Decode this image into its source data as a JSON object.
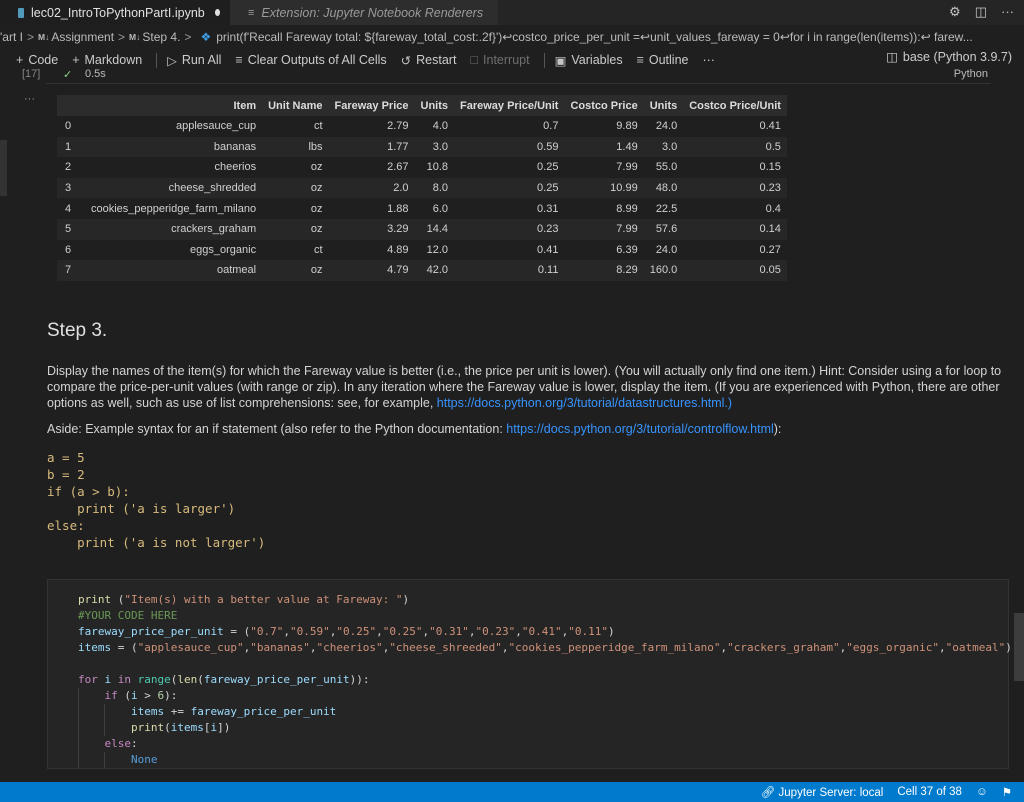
{
  "tabs": [
    {
      "label": "lec02_IntroToPythonPartI.ipynb",
      "modified": true
    },
    {
      "label": "Extension: Jupyter Notebook Renderers"
    }
  ],
  "breadcrumb": {
    "items": [
      "'art I",
      "Assignment",
      "Step 4."
    ],
    "cell_preview": "print(f'Recall Fareway total: ${fareway_total_cost:.2f}')↩costco_price_per_unit =↩unit_values_fareway = 0↩for i in range(len(items)):↩    farew..."
  },
  "toolbar": {
    "code": "Code",
    "markdown": "Markdown",
    "run_all": "Run All",
    "clear_outputs": "Clear Outputs of All Cells",
    "restart": "Restart",
    "interrupt": "Interrupt",
    "variables": "Variables",
    "outline": "Outline",
    "more": "···",
    "kernel": "base (Python 3.9.7)"
  },
  "cell_status": {
    "count": "[17]",
    "time": "0.5s",
    "language": "Python"
  },
  "dataframe": {
    "columns": [
      "",
      "Item",
      "Unit Name",
      "Fareway Price",
      "Units",
      "Fareway Price/Unit",
      "Costco Price",
      "Units",
      "Costco Price/Unit"
    ],
    "rows": [
      [
        "0",
        "applesauce_cup",
        "ct",
        "2.79",
        "4.0",
        "0.7",
        "9.89",
        "24.0",
        "0.41"
      ],
      [
        "1",
        "bananas",
        "lbs",
        "1.77",
        "3.0",
        "0.59",
        "1.49",
        "3.0",
        "0.5"
      ],
      [
        "2",
        "cheerios",
        "oz",
        "2.67",
        "10.8",
        "0.25",
        "7.99",
        "55.0",
        "0.15"
      ],
      [
        "3",
        "cheese_shredded",
        "oz",
        "2.0",
        "8.0",
        "0.25",
        "10.99",
        "48.0",
        "0.23"
      ],
      [
        "4",
        "cookies_pepperidge_farm_milano",
        "oz",
        "1.88",
        "6.0",
        "0.31",
        "8.99",
        "22.5",
        "0.4"
      ],
      [
        "5",
        "crackers_graham",
        "oz",
        "3.29",
        "14.4",
        "0.23",
        "7.99",
        "57.6",
        "0.14"
      ],
      [
        "6",
        "eggs_organic",
        "ct",
        "4.89",
        "12.0",
        "0.41",
        "6.39",
        "24.0",
        "0.27"
      ],
      [
        "7",
        "oatmeal",
        "oz",
        "4.79",
        "42.0",
        "0.11",
        "8.29",
        "160.0",
        "0.05"
      ]
    ]
  },
  "markdown": {
    "heading": "Step 3.",
    "para1": "Display the names of the item(s) for which the Fareway value is better (i.e., the price per unit is lower). (You will actually only find one item.) Hint: Consider using a for loop to compare the price-per-unit values (with range or zip). In any iteration where the Fareway value is lower, display the item. (If you are experienced with Python, there are other options as well, such as use of list comprehensions: see, for example, ",
    "link1": "https://docs.python.org/3/tutorial/datastructures.html.)",
    "para2": "Aside: Example syntax for an if statement (also refer to the Python documentation: ",
    "link2": "https://docs.python.org/3/tutorial/controlflow.html",
    "para2_end": "):",
    "example_code": "a = 5\nb = 2\nif (a > b):\n    print ('a is larger')\nelse:\n    print ('a is not larger')"
  },
  "code_cell": {
    "lines": [
      "print (\"Item(s) with a better value at Fareway: \")",
      "#YOUR CODE HERE",
      "fareway_price_per_unit = (\"0.7\",\"0.59\",\"0.25\",\"0.25\",\"0.31\",\"0.23\",\"0.41\",\"0.11\")",
      "items = (\"applesauce_cup\",\"bananas\",\"cheerios\",\"cheese_shreeded\",\"cookies_pepperidge_farm_milano\",\"crackers_graham\",\"eggs_organic\",\"oatmeal\")",
      "",
      "for i in range(len(fareway_price_per_unit)):",
      "    if (i > 6):",
      "        items += fareway_price_per_unit",
      "        print(items[i])",
      "    else:",
      "        None"
    ]
  },
  "status_bar": {
    "server": "Jupyter Server: local",
    "cell_position": "Cell 37 of 38"
  }
}
